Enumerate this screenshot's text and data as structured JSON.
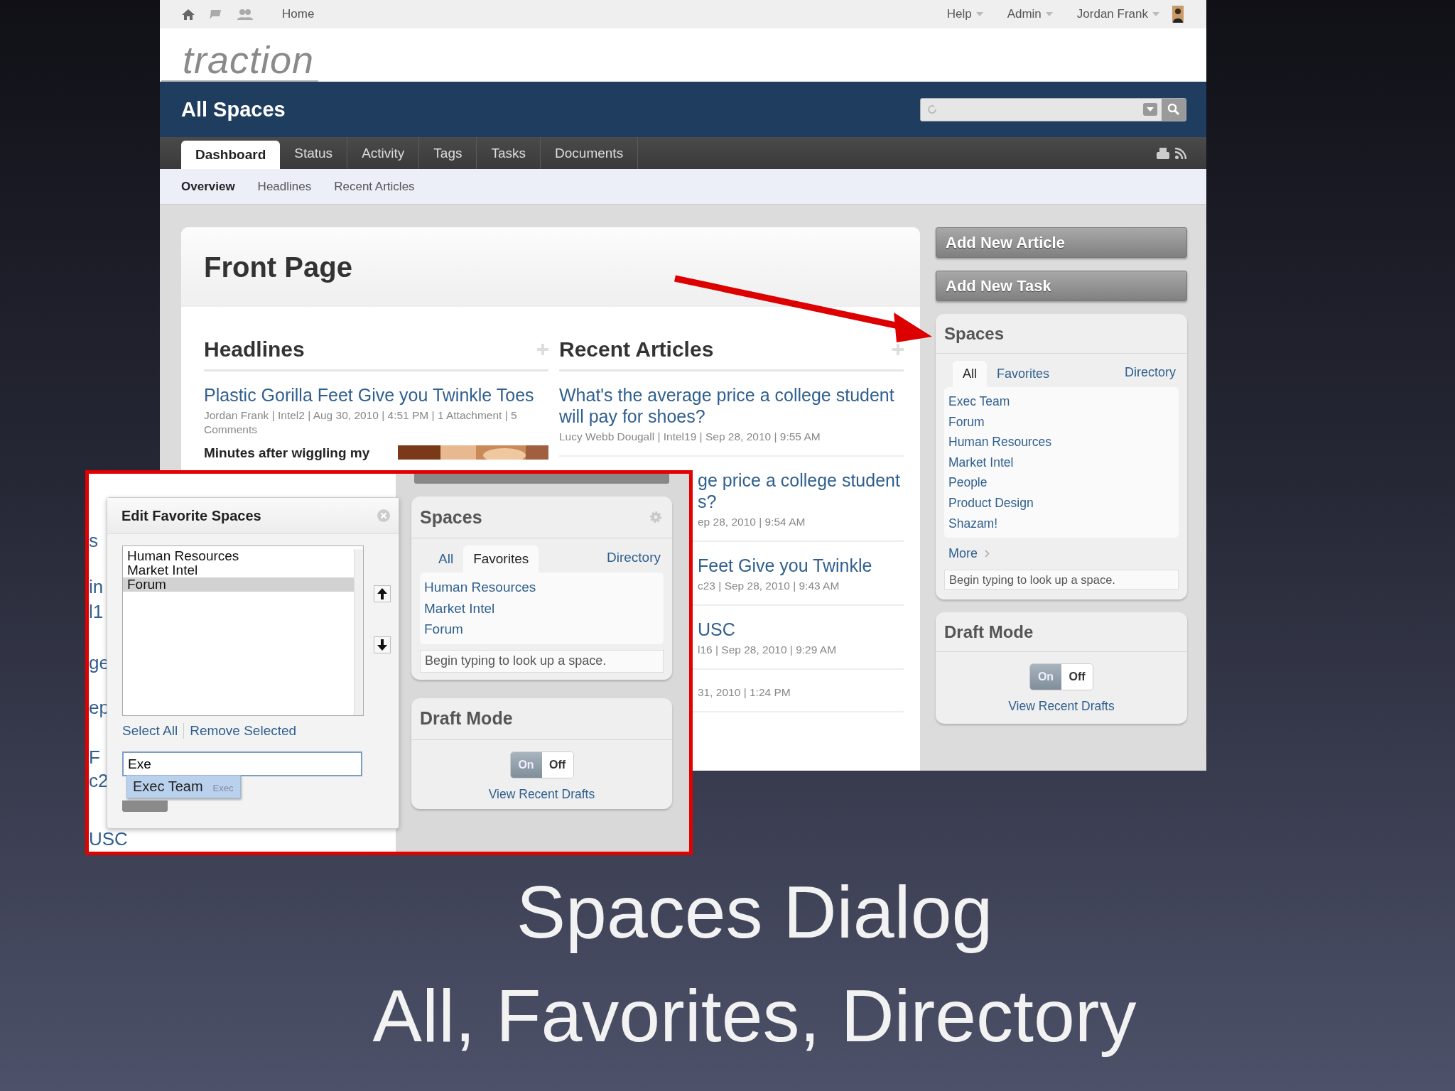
{
  "top_bar": {
    "breadcrumb": "Home",
    "menus": [
      {
        "label": "Help"
      },
      {
        "label": "Admin"
      },
      {
        "label": "Jordan Frank"
      }
    ]
  },
  "logo": "traction",
  "space_title": "All Spaces",
  "tabs": [
    {
      "label": "Dashboard",
      "selected": true
    },
    {
      "label": "Status",
      "selected": false
    },
    {
      "label": "Activity",
      "selected": false
    },
    {
      "label": "Tags",
      "selected": false
    },
    {
      "label": "Tasks",
      "selected": false
    },
    {
      "label": "Documents",
      "selected": false
    }
  ],
  "subnav": [
    {
      "label": "Overview",
      "selected": true
    },
    {
      "label": "Headlines",
      "selected": false
    },
    {
      "label": "Recent Articles",
      "selected": false
    }
  ],
  "front_page": {
    "title": "Front Page",
    "headlines": {
      "heading": "Headlines",
      "articles": [
        {
          "title": "Plastic Gorilla Feet Give you Twinkle Toes",
          "meta": "Jordan Frank | Intel2 | Aug 30, 2010 | 4:51 PM | 1 Attachment | 5 Comments",
          "excerpt": "Minutes after wiggling my"
        }
      ]
    },
    "recent_articles": {
      "heading": "Recent Articles",
      "articles": [
        {
          "kind": "full",
          "title": "What's the average price a college student will pay for shoes?",
          "meta": "Lucy Webb Dougall | Intel19 | Sep 28, 2010 | 9:55 AM"
        },
        {
          "kind": "covered",
          "title": "ge price a college student\ns?",
          "meta": "ep 28, 2010 | 9:54 AM"
        },
        {
          "kind": "covered",
          "title": "Feet Give you Twinkle",
          "meta": "c23 | Sep 28, 2010 | 9:43 AM"
        },
        {
          "kind": "covered",
          "title": "USC",
          "meta": "l16 | Sep 28, 2010 | 9:29 AM"
        },
        {
          "kind": "covered",
          "meta": "31, 2010 | 1:24 PM"
        }
      ]
    }
  },
  "sidebar": {
    "buttons": [
      "Add New Article",
      "Add New Task"
    ],
    "spaces": {
      "title": "Spaces",
      "tabs": [
        {
          "label": "All",
          "selected": true
        },
        {
          "label": "Favorites",
          "selected": false
        }
      ],
      "directory": "Directory",
      "items": [
        "Exec Team",
        "Forum",
        "Human Resources",
        "Market Intel",
        "People",
        "Product Design",
        "Shazam!"
      ],
      "more": "More",
      "lookup_placeholder": "Begin typing to look up a space."
    },
    "draft_mode": {
      "title": "Draft Mode",
      "toggle": [
        {
          "label": "On",
          "selected": true
        },
        {
          "label": "Off",
          "selected": false
        }
      ],
      "link": "View Recent Drafts"
    }
  },
  "inset": {
    "page_fragments": [
      "s",
      "in",
      "l1",
      "ge",
      "ep",
      "F",
      "c2",
      "USC"
    ],
    "dialog": {
      "title": "Edit Favorite Spaces",
      "list": [
        {
          "label": "Human Resources",
          "selected": false
        },
        {
          "label": "Market Intel",
          "selected": false
        },
        {
          "label": "Forum",
          "selected": true
        }
      ],
      "links": [
        "Select All",
        "Remove Selected"
      ],
      "input_value": "Exe",
      "suggestion": {
        "label": "Exec Team",
        "hint": "Exec"
      }
    },
    "spaces": {
      "title": "Spaces",
      "settings": true,
      "tabs": [
        {
          "label": "All",
          "selected": false
        },
        {
          "label": "Favorites",
          "selected": true
        }
      ],
      "directory": "Directory",
      "items": [
        "Human Resources",
        "Market Intel",
        "Forum"
      ],
      "lookup_placeholder": "Begin typing to look up a space."
    },
    "draft_mode": {
      "title": "Draft Mode",
      "toggle": [
        {
          "label": "On",
          "selected": true
        },
        {
          "label": "Off",
          "selected": false
        }
      ],
      "link": "View Recent Drafts"
    }
  },
  "caption": [
    "Spaces Dialog",
    "All, Favorites, Directory"
  ]
}
